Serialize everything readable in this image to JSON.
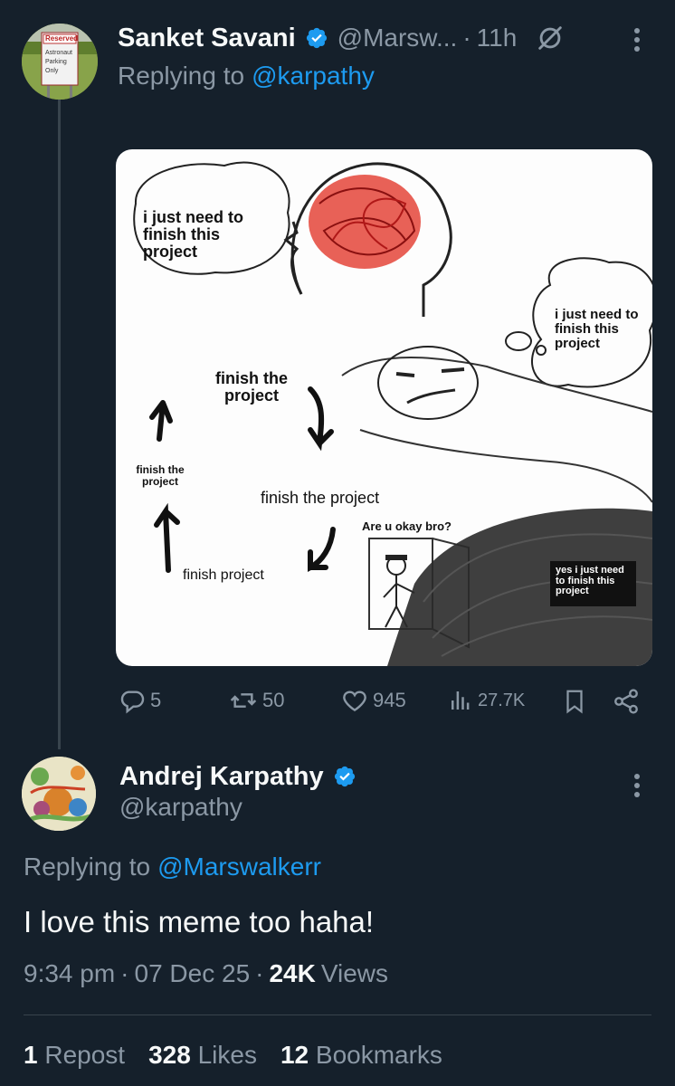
{
  "reply_tweet": {
    "display_name": "Sanket Savani",
    "handle": "@Marsw...",
    "time": "11h",
    "replying_prefix": "Replying to",
    "replying_to": "@karpathy",
    "avatar_sign": {
      "top": "Reserved",
      "lines": [
        "Astronaut",
        "Parking",
        "Only"
      ]
    },
    "meme": {
      "thought_1": "i just need to finish this project",
      "thought_2": "i just need to finish this project",
      "cycle_1": "finish the project",
      "cycle_2": "finish the project",
      "cycle_3": "finish the project",
      "cycle_4": "finish project",
      "question": "Are u okay bro?",
      "answer": "yes i just need to finish this project"
    },
    "actions": {
      "replies": "5",
      "reposts": "50",
      "likes": "945",
      "views": "27.7K"
    }
  },
  "main_tweet": {
    "display_name": "Andrej Karpathy",
    "handle": "@karpathy",
    "replying_prefix": "Replying to",
    "replying_to": "@Marswalkerr",
    "text": "I love this meme too haha!",
    "time": "9:34 pm",
    "date": "07 Dec 25",
    "views_count": "24K",
    "views_label": "Views",
    "stats": {
      "reposts_count": "1",
      "reposts_label": "Repost",
      "likes_count": "328",
      "likes_label": "Likes",
      "bookmarks_count": "12",
      "bookmarks_label": "Bookmarks"
    }
  },
  "colors": {
    "background": "#15202b",
    "accent": "#1d9bf0",
    "muted": "#8b98a5",
    "divider": "#38444d"
  }
}
